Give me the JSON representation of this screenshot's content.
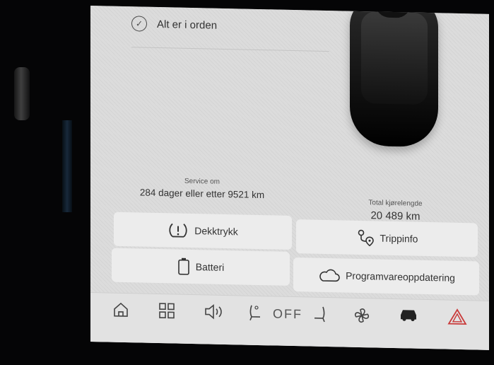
{
  "status": {
    "text": "Alt er i orden"
  },
  "service": {
    "label": "Service om",
    "value": "284 dager eller etter 9521 km"
  },
  "odometer": {
    "label": "Total kjørelengde",
    "value": "20 489 km"
  },
  "tiles": {
    "dekktrykk": "Dekktrykk",
    "trippinfo": "Trippinfo",
    "batteri": "Batteri",
    "programvare": "Programvareoppdatering"
  },
  "bottom": {
    "off_label": "OFF"
  },
  "colors": {
    "accent": "#c93a3a",
    "tile": "#ececec",
    "screen": "#dcdcdc"
  },
  "icons": {
    "status": "check-circle-icon",
    "dekk": "tire-pressure-icon",
    "trip": "route-icon",
    "batt": "battery-icon",
    "prog": "cloud-icon",
    "home": "home-icon",
    "apps": "grid-icon",
    "volume": "volume-icon",
    "seat": "seat-icon",
    "fan": "fan-icon",
    "car": "car-icon",
    "hazard": "hazard-icon"
  }
}
